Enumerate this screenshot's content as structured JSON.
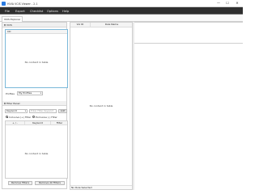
{
  "window": {
    "title": "HVIA VCIS Viewer - 2.1",
    "minimize_glyph": "—",
    "maximize_glyph": "☐",
    "close_glyph": "✕"
  },
  "menu": [
    "File",
    "Export",
    "Checklist",
    "Options",
    "Help"
  ],
  "tabs": [
    "VCIS Explorer"
  ],
  "vcis_section": {
    "header": "VCIS",
    "table_header": "CD",
    "empty_text": "No content in table",
    "profiles_label": "Profiles",
    "profiles_value": "My Profiles"
  },
  "filter_panel": {
    "header": "Filter Panel",
    "keyword_option": "Keyword",
    "keyword_placeholder": "Enter Filter Keyword",
    "add_label": "Add",
    "inclusive_label": "Inclusive (+) Filter",
    "exclusive_label": "Exclusive (-) Filter",
    "columns": [
      "+ / -",
      "Keyword",
      "Filter"
    ],
    "empty_text": "No content in table",
    "remove_filters_label": "Remove Filters",
    "remove_all_filters_label": "Remove All Filters"
  },
  "rules_panel": {
    "columns": [
      "Vul ID",
      "Rule Name"
    ],
    "empty_text": "No content in table",
    "status": "No Rule Selected"
  },
  "colors": {
    "menubar_bg": "#2f2f2f",
    "accent_border": "#7ab8d9",
    "app_icon": "#2a7be0"
  }
}
